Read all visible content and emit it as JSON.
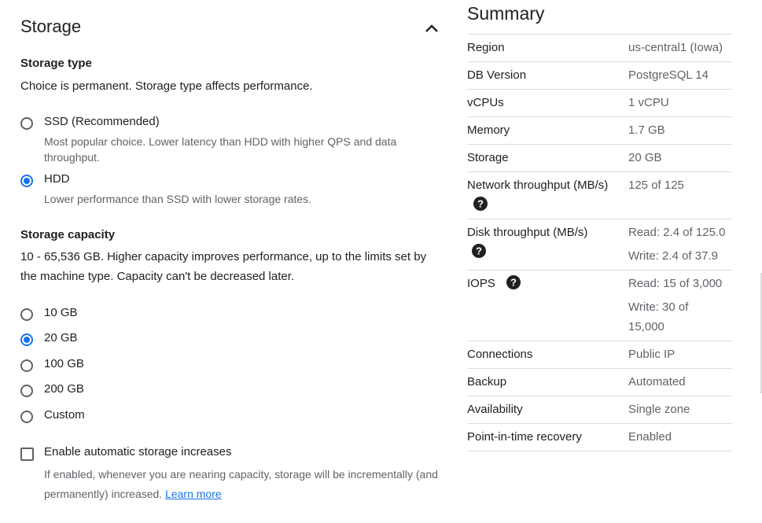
{
  "storage": {
    "title": "Storage",
    "collapse_icon": "chevron-up-icon",
    "storage_type": {
      "heading": "Storage type",
      "description": "Choice is permanent. Storage type affects performance.",
      "options": [
        {
          "label": "SSD (Recommended)",
          "hint": "Most popular choice. Lower latency than HDD with higher QPS and data throughput.",
          "checked": false
        },
        {
          "label": "HDD",
          "hint": "Lower performance than SSD with lower storage rates.",
          "checked": true
        }
      ]
    },
    "storage_capacity": {
      "heading": "Storage capacity",
      "description": "10 - 65,536 GB. Higher capacity improves performance, up to the limits set by the machine type. Capacity can't be decreased later.",
      "options": [
        {
          "label": "10 GB",
          "checked": false
        },
        {
          "label": "20 GB",
          "checked": true
        },
        {
          "label": "100 GB",
          "checked": false
        },
        {
          "label": "200 GB",
          "checked": false
        },
        {
          "label": "Custom",
          "checked": false
        }
      ]
    },
    "auto_increase": {
      "label": "Enable automatic storage increases",
      "checked": false,
      "hint": "If enabled, whenever you are nearing capacity, storage will be incrementally (and permanently) increased.",
      "link": "Learn more"
    }
  },
  "summary": {
    "title": "Summary",
    "rows": [
      {
        "key": "Region",
        "value": "us-central1 (Iowa)"
      },
      {
        "key": "DB Version",
        "value": "PostgreSQL 14"
      },
      {
        "key": "vCPUs",
        "value": "1 vCPU"
      },
      {
        "key": "Memory",
        "value": "1.7 GB"
      },
      {
        "key": "Storage",
        "value": "20 GB"
      },
      {
        "key": "Network throughput (MB/s)",
        "value": "125 of 125",
        "help": true
      },
      {
        "key": "Disk throughput (MB/s)",
        "values": [
          "Read: 2.4 of 125.0",
          "Write: 2.4 of 37.9"
        ],
        "help": true
      },
      {
        "key": "IOPS",
        "values": [
          "Read: 15 of 3,000",
          "Write: 30 of 15,000"
        ],
        "help": true
      },
      {
        "key": "Connections",
        "value": "Public IP"
      },
      {
        "key": "Backup",
        "value": "Automated"
      },
      {
        "key": "Availability",
        "value": "Single zone"
      },
      {
        "key": "Point-in-time recovery",
        "value": "Enabled"
      }
    ],
    "help_icon": "help-icon"
  }
}
